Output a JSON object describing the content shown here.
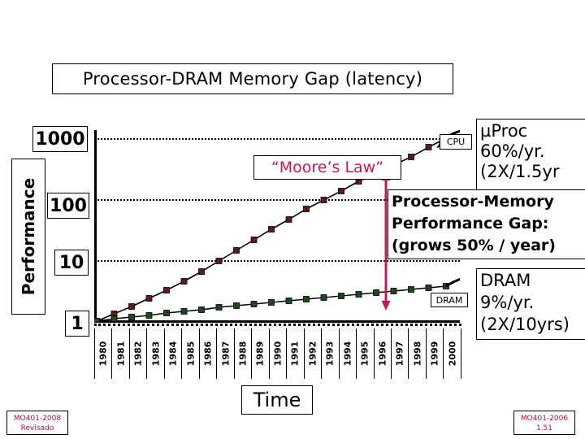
{
  "title": "Processor-DRAM Memory Gap (latency)",
  "axes": {
    "y_label": "Performance",
    "y_ticks": [
      "1000",
      "100",
      "10",
      "1"
    ],
    "x_label": "Time",
    "x_ticks": [
      "1980",
      "1981",
      "1982",
      "1983",
      "1984",
      "1985",
      "1986",
      "1987",
      "1988",
      "1989",
      "1990",
      "1991",
      "1992",
      "1993",
      "1994",
      "1995",
      "1996",
      "1997",
      "1998",
      "1999",
      "2000"
    ]
  },
  "annotations": {
    "moore": "“Moore’s Law”",
    "cpu_tag": "CPU",
    "dram_tag": "DRAM",
    "proc_note": [
      "µProc",
      "60%/yr.",
      "(2X/1.5yr"
    ],
    "gap_note": [
      "Processor-Memory",
      "Performance Gap:",
      "(grows 50% / year)"
    ],
    "dram_note": [
      "DRAM",
      "9%/yr.",
      "(2X/10yrs)"
    ]
  },
  "footer": {
    "left_line1": "MO401-2008",
    "left_line2": "Revisado",
    "right_line1": "MO401-2006",
    "right_line2": "1.51"
  },
  "colors": {
    "moore_text": "#c2185b",
    "gap_arrow": "#c2185b",
    "cpu_marker": "#5c1a1a",
    "dram_marker": "#1e4620",
    "footer_text": "#b01050",
    "line": "#000000"
  },
  "chart_data": {
    "type": "line",
    "title": "Processor-DRAM Memory Gap (latency)",
    "xlabel": "Time",
    "ylabel": "Performance",
    "ylim": [
      1,
      1000
    ],
    "yscale": "log",
    "grid": true,
    "legend": "inline-labels",
    "x": [
      1980,
      1981,
      1982,
      1983,
      1984,
      1985,
      1986,
      1987,
      1988,
      1989,
      1990,
      1991,
      1992,
      1993,
      1994,
      1995,
      1996,
      1997,
      1998,
      1999,
      2000
    ],
    "series": [
      {
        "name": "CPU",
        "growth": "60%/yr. (2X/1.5yr)",
        "values": [
          1,
          1.3,
          1.8,
          2.6,
          3.8,
          5.5,
          8,
          12,
          18,
          27,
          40,
          58,
          85,
          120,
          170,
          240,
          330,
          450,
          600,
          800,
          1000
        ]
      },
      {
        "name": "DRAM",
        "growth": "9%/yr. (2X/10yrs)",
        "values": [
          1,
          1.09,
          1.19,
          1.3,
          1.41,
          1.54,
          1.68,
          1.83,
          1.99,
          2.17,
          2.37,
          2.58,
          2.81,
          3.07,
          3.34,
          3.64,
          3.97,
          4.33,
          4.72,
          5.14,
          5.6
        ]
      }
    ],
    "gap_annotation": {
      "label": "Processor-Memory Performance Gap: (grows 50% / year)",
      "at_x": 1996,
      "from_y": 4,
      "to_y": 250
    }
  }
}
